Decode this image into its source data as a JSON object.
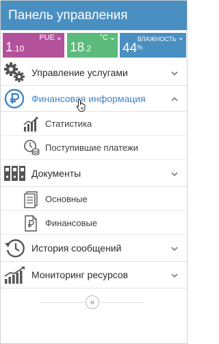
{
  "header": {
    "title": "Панель управления"
  },
  "tiles": [
    {
      "label": "PUE",
      "value_main": "1",
      "value_small": ".10",
      "sup": "",
      "color": "#b3529b"
    },
    {
      "label": "°C",
      "value_main": "18",
      "value_small": ".2",
      "sup": "",
      "color": "#5cba7b"
    },
    {
      "label": "ВЛАЖНОСТЬ",
      "value_main": "44",
      "value_small": "",
      "sup": "%",
      "color": "#4a8fc2"
    }
  ],
  "menu": {
    "services": {
      "label": "Управление услугами",
      "icon": "gears-icon"
    },
    "finance": {
      "label": "Финансовая информация",
      "icon": "ruble-circle-icon",
      "children": [
        {
          "label": "Статистика",
          "icon": "bar-chart-icon"
        },
        {
          "label": "Поступившие платежи",
          "icon": "payments-icon"
        }
      ]
    },
    "documents": {
      "label": "Документы",
      "icon": "binders-icon",
      "children": [
        {
          "label": "Основные",
          "icon": "document-icon"
        },
        {
          "label": "Финансовые",
          "icon": "ruble-document-icon"
        }
      ]
    },
    "history": {
      "label": "История сообщений",
      "icon": "history-icon"
    },
    "monitoring": {
      "label": "Мониторинг ресурсов",
      "icon": "monitoring-chart-icon"
    }
  },
  "footer": {
    "collapse_glyph": "«"
  },
  "colors": {
    "header": "#4a8fc2",
    "active_text": "#3d85c6",
    "icon_gray": "#555555"
  }
}
